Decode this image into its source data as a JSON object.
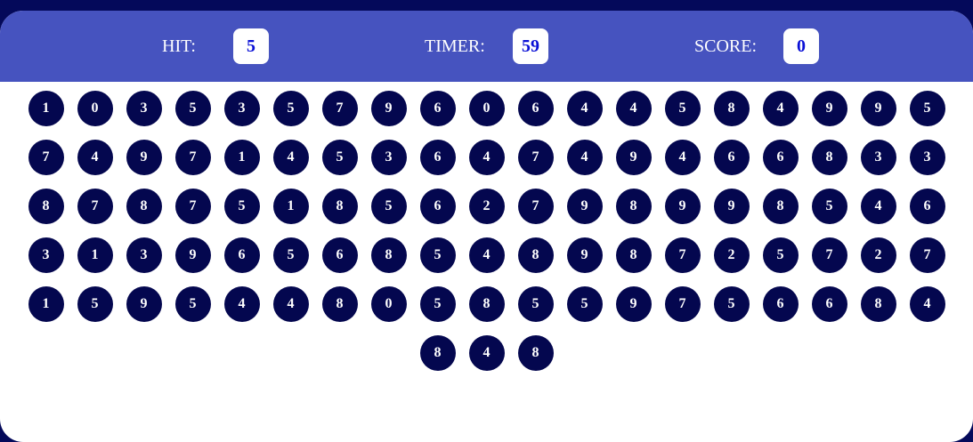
{
  "header": {
    "hit_label": "HIT:",
    "hit_value": "5",
    "timer_label": "TIMER:",
    "timer_value": "59",
    "score_label": "SCORE:",
    "score_value": "0"
  },
  "colors": {
    "page_background": "#04095a",
    "header_background": "#4653bf",
    "panel_background": "#ffffff",
    "bubble_fill": "#04074f",
    "bubble_text": "#ffffff",
    "value_text": "#0a10d6"
  },
  "bubbles": [
    "1",
    "0",
    "3",
    "5",
    "3",
    "5",
    "7",
    "9",
    "6",
    "0",
    "6",
    "4",
    "4",
    "5",
    "8",
    "4",
    "9",
    "9",
    "5",
    "7",
    "4",
    "9",
    "7",
    "1",
    "4",
    "5",
    "3",
    "6",
    "4",
    "7",
    "4",
    "9",
    "4",
    "6",
    "6",
    "8",
    "3",
    "3",
    "8",
    "7",
    "8",
    "7",
    "5",
    "1",
    "8",
    "5",
    "6",
    "2",
    "7",
    "9",
    "8",
    "9",
    "9",
    "8",
    "5",
    "4",
    "6",
    "3",
    "1",
    "3",
    "9",
    "6",
    "5",
    "6",
    "8",
    "5",
    "4",
    "8",
    "9",
    "8",
    "7",
    "2",
    "5",
    "7",
    "2",
    "7",
    "1",
    "5",
    "9",
    "5",
    "4",
    "4",
    "8",
    "0",
    "5",
    "8",
    "5",
    "5",
    "9",
    "7",
    "5",
    "6",
    "6",
    "8",
    "4",
    "8",
    "4",
    "8"
  ]
}
